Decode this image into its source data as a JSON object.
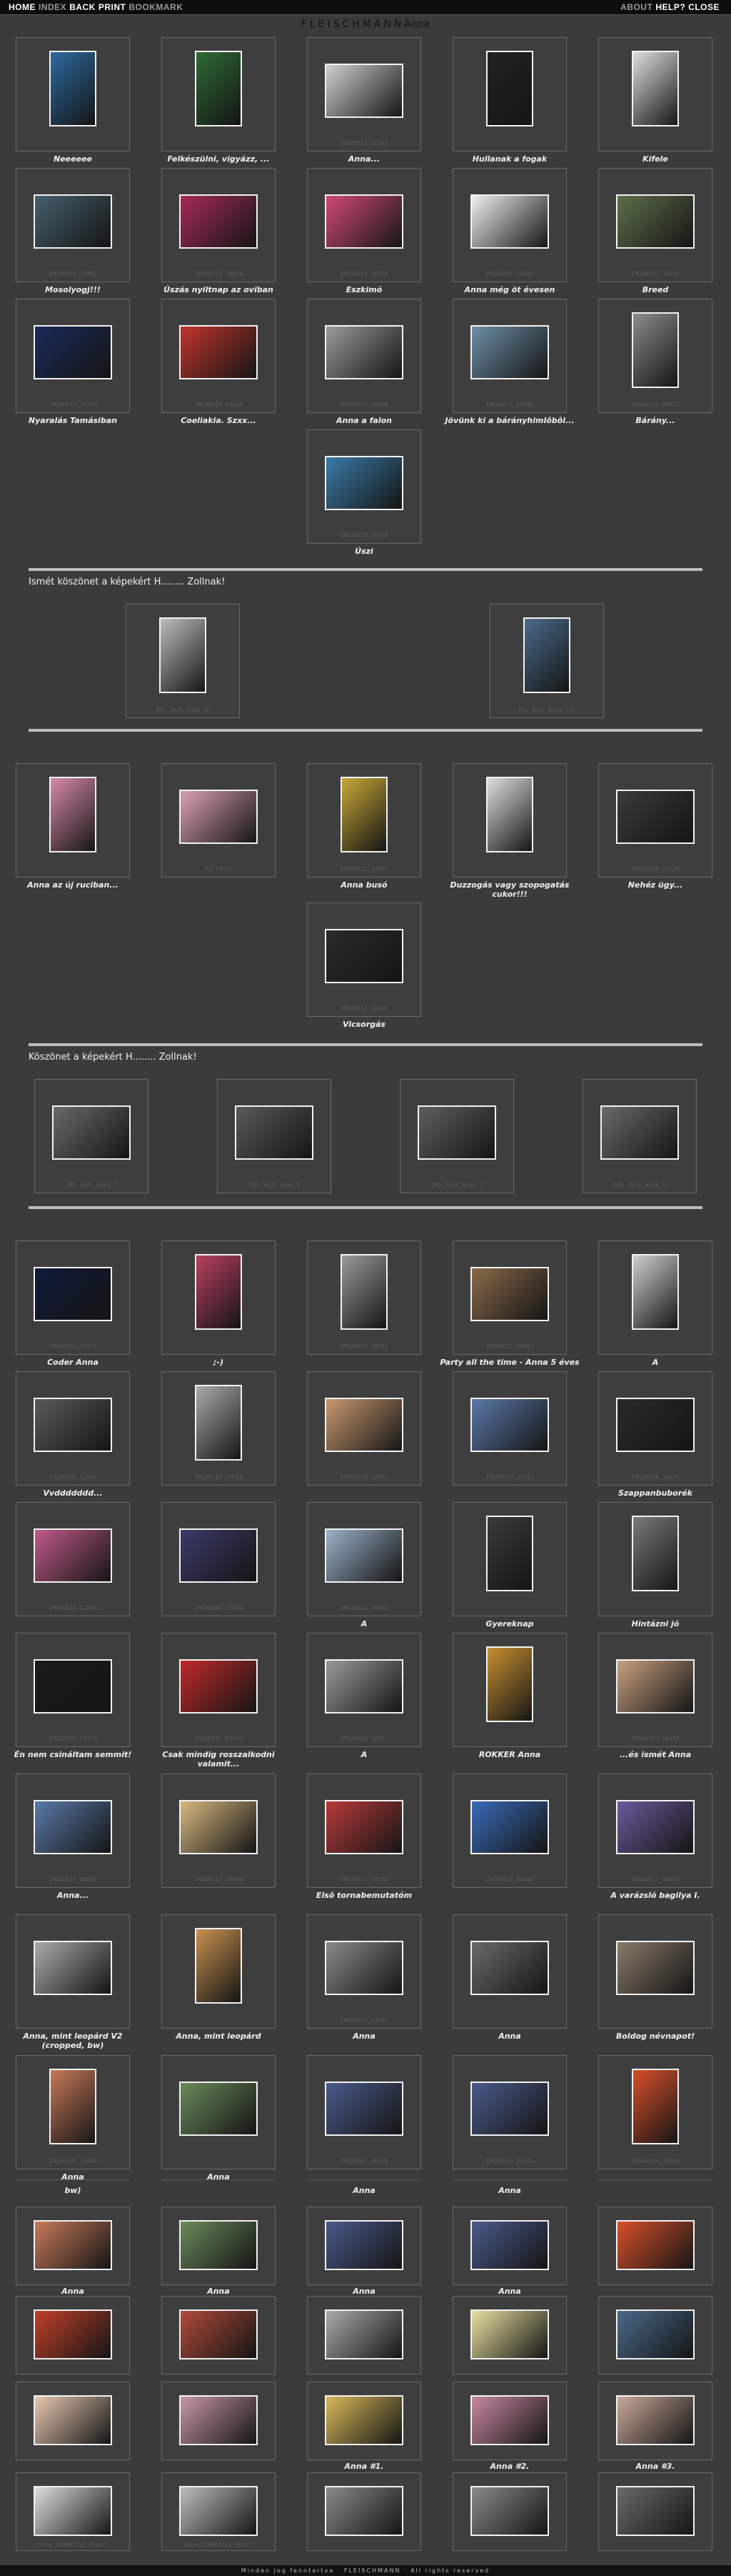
{
  "nav": {
    "left": [
      {
        "label": "HOME",
        "style": "white"
      },
      {
        "label": "INDEX",
        "style": "dim"
      },
      {
        "label": "BACK",
        "style": "white"
      },
      {
        "label": "PRINT",
        "style": "white"
      },
      {
        "label": "BOOKMARK",
        "style": "dim"
      }
    ],
    "right": [
      {
        "label": "ABOUT",
        "style": "dim"
      },
      {
        "label": "HELP?",
        "style": "white"
      },
      {
        "label": "CLOSE",
        "style": "white"
      }
    ]
  },
  "header": {
    "brand": "FLEISCHMANN",
    "subtitle": "Anna"
  },
  "sections": [
    {
      "title": "",
      "rows": [
        [
          {
            "caption": "Neeeeee",
            "file": "",
            "tone": "#2c6aa0",
            "portrait": true
          },
          {
            "caption": "Felkészülni, vigyázz, ...",
            "file": "",
            "tone": "#2f6a34",
            "portrait": true
          },
          {
            "caption": "Anna...",
            "file": "IMG00021_22585",
            "tone": "#cfcfcf",
            "portrait": false
          },
          {
            "caption": "Hullanak a fogak",
            "file": "",
            "tone": "#222222",
            "portrait": true
          },
          {
            "caption": "Kifele",
            "file": "",
            "tone": "#dedede",
            "portrait": true
          }
        ],
        [
          {
            "caption": "Mosolyogj!!!",
            "file": "IMG00019_13882",
            "tone": "#46606e",
            "portrait": false
          },
          {
            "caption": "Úszás nyiltnap az oviban",
            "file": "IMG00516_18876",
            "tone": "#a62a5a",
            "portrait": false
          },
          {
            "caption": "Eszkimó",
            "file": "IMG00014_18126",
            "tone": "#d14a76",
            "portrait": false
          },
          {
            "caption": "Anna még öt évesen",
            "file": "IMG00007_10064",
            "tone": "#f0f0f0",
            "portrait": false
          },
          {
            "caption": "Breed",
            "file": "IMG00567_16641",
            "tone": "#5e6f4a",
            "portrait": false
          }
        ],
        [
          {
            "caption": "Nyaralás Tamásiban",
            "file": "IMG00574_19226",
            "tone": "#1c2b5a",
            "portrait": false
          },
          {
            "caption": "Coeliakia. Szxx...",
            "file": "IMG00516_00474",
            "tone": "#c0362e",
            "portrait": false
          },
          {
            "caption": "Anna a falon",
            "file": "IMG00511_00606",
            "tone": "#9a9a9a",
            "portrait": false
          },
          {
            "caption": "Jövünk ki a bárányhimlőből...",
            "file": "IMG00516_00606",
            "tone": "#6e90a8",
            "portrait": false
          },
          {
            "caption": "Bárány...",
            "file": "IMG00511_00477",
            "tone": "#8c8c8c",
            "portrait": true
          }
        ],
        [
          {
            "caption": "Úszi",
            "file": "IMG00518_00599",
            "tone": "#3a7ba8",
            "portrait": false
          }
        ]
      ]
    },
    {
      "title": "Ismét köszönet a képekért H........ Zollnak!",
      "rows": [
        [
          {
            "caption": "",
            "file": "IMG_3626_Anna_bw",
            "tone": "#bdbdbd",
            "portrait": true
          },
          {
            "caption": "",
            "file": "IMG_3626_Anna_col",
            "tone": "#4a6a8a",
            "portrait": true
          }
        ]
      ]
    },
    {
      "title": "",
      "rows": [
        [
          {
            "caption": "Anna az új ruciban...",
            "file": "",
            "tone": "#d88aa8",
            "portrait": true
          },
          {
            "caption": "",
            "file": "PICT0033",
            "tone": "#d9a0b0",
            "portrait": false
          },
          {
            "caption": "Anna busó",
            "file": "IMG00512_14007",
            "tone": "#c8a838",
            "portrait": true
          },
          {
            "caption": "Duzzogás vagy szopogatás cukor!!!",
            "file": "",
            "tone": "#dedede",
            "portrait": true
          },
          {
            "caption": "Nehéz ügy...",
            "file": "IMG00518_00320",
            "tone": "#3a3a3a",
            "portrait": false
          }
        ],
        [
          {
            "caption": "Vicsorgás",
            "file": "IMG00518_00305",
            "tone": "#2a2a2a",
            "portrait": false
          }
        ]
      ]
    },
    {
      "title": "Köszönet a képekért H........ Zollnak!",
      "rows": [
        [
          {
            "caption": "",
            "file": "IMG_3642_anna_1",
            "tone": "#6a6a6a",
            "portrait": false
          },
          {
            "caption": "",
            "file": "IMG_3626_anna_2",
            "tone": "#5a5a5a",
            "portrait": false
          },
          {
            "caption": "",
            "file": "IMG_3626_anna_3",
            "tone": "#5f5f5f",
            "portrait": false
          },
          {
            "caption": "",
            "file": "IMG_3626_anna_4",
            "tone": "#6a6a6a",
            "portrait": false
          }
        ]
      ]
    },
    {
      "title": "",
      "rows": [
        [
          {
            "caption": "Coder Anna",
            "file": "IMG00516_01022",
            "tone": "#0f1a3a",
            "portrait": false
          },
          {
            "caption": ";-)",
            "file": "",
            "tone": "#b94060",
            "portrait": true
          },
          {
            "caption": "",
            "file": "IMG00518_08601",
            "tone": "#9a9a9a",
            "portrait": true
          },
          {
            "caption": "Party all the time - Anna 5 éves",
            "file": "IMG00516_06887",
            "tone": "#8a6a4a",
            "portrait": false
          },
          {
            "caption": "A",
            "file": "",
            "tone": "#cfcfcf",
            "portrait": true
          }
        ],
        [
          {
            "caption": "Vvddddddd...",
            "file": "IMG00518_12005",
            "tone": "#5a5a5a",
            "portrait": false
          },
          {
            "caption": "",
            "file": "IMG00518_08621",
            "tone": "#aaaaaa",
            "portrait": true
          },
          {
            "caption": "",
            "file": "IMG00518_08862",
            "tone": "#c89870",
            "portrait": false
          },
          {
            "caption": "",
            "file": "IMG00519_09682",
            "tone": "#5a78a8",
            "portrait": false
          },
          {
            "caption": "Szappanbuborék",
            "file": "IMG00518_10686",
            "tone": "#2a2a2a",
            "portrait": false
          }
        ],
        [
          {
            "caption": "",
            "file": "IMG00510_12009",
            "tone": "#c05a8a",
            "portrait": false
          },
          {
            "caption": "",
            "file": "IMG00509_22440",
            "tone": "#3a3a6a",
            "portrait": false
          },
          {
            "caption": "A",
            "file": "IMG00510_08402",
            "tone": "#9ab0c8",
            "portrait": false
          },
          {
            "caption": "Gyereknap",
            "file": "",
            "tone": "#3a3a3a",
            "portrait": true
          },
          {
            "caption": "Hintázni jó",
            "file": "",
            "tone": "#7a7a7a",
            "portrait": true
          }
        ],
        [
          {
            "caption": "Én nem csináltam semmit!",
            "file": "IMG00506_18328",
            "tone": "#1a1a1a",
            "portrait": false
          },
          {
            "caption": "Csak mindig rosszalkodni valamit...",
            "file": "IMG00516_00407",
            "tone": "#c02a2a",
            "portrait": false
          },
          {
            "caption": "A",
            "file": "IMG00506_18812",
            "tone": "#9a9a9a",
            "portrait": false
          },
          {
            "caption": "ROKKER Anna",
            "file": "",
            "tone": "#c89030",
            "portrait": true
          },
          {
            "caption": "...és ismét Anna",
            "file": "IMG00503_08488",
            "tone": "#c8a080",
            "portrait": false
          }
        ],
        [
          {
            "caption": "Anna...",
            "file": "IMG00511_08885",
            "tone": "#5a7aa8",
            "portrait": false
          },
          {
            "caption": "",
            "file": "IMG00517_06690",
            "tone": "#d8b880",
            "portrait": false
          },
          {
            "caption": "Első tornabemutatóm",
            "file": "IMG00517_17436",
            "tone": "#b83a3a",
            "portrait": false
          },
          {
            "caption": "",
            "file": "IMG00516_00408",
            "tone": "#3a6ab8",
            "portrait": false
          },
          {
            "caption": "A varázsló bagilya I.",
            "file": "IMG00517_06436",
            "tone": "#6a5a9a",
            "portrait": false
          }
        ],
        [
          {
            "caption": "Anna, mint leopárd V2 (cropped, bw)",
            "file": "",
            "tone": "#aaaaaa",
            "portrait": false
          },
          {
            "caption": "Anna, mint leopárd",
            "file": "",
            "tone": "#c89050",
            "portrait": true
          },
          {
            "caption": "Anna",
            "file": "IMG00516_12681",
            "tone": "#8a8a8a",
            "portrait": false
          },
          {
            "caption": "Anna",
            "file": "",
            "tone": "#6a6a6a",
            "portrait": false
          },
          {
            "caption": "Boldog névnapot!",
            "file": "",
            "tone": "#8a7a6a",
            "portrait": false
          }
        ],
        [
          {
            "caption": "Anna",
            "file": "IMG00510_15883",
            "tone": "#c87a5a",
            "portrait": true
          },
          {
            "caption": "Anna",
            "file": "",
            "tone": "#6a8a5a",
            "portrait": false
          },
          {
            "caption": "",
            "file": "IMG00507_08109",
            "tone": "#4a5a8a",
            "portrait": false
          },
          {
            "caption": "",
            "file": "IMG00510_08109",
            "tone": "#4a5a8a",
            "portrait": false
          },
          {
            "caption": "",
            "file": "IMG00514_18006",
            "tone": "#d8502a",
            "portrait": true
          }
        ]
      ]
    }
  ],
  "ghost_strip": [
    {
      "caption": "bw)"
    },
    {
      "caption": ""
    },
    {
      "caption": "Anna"
    },
    {
      "caption": "Anna"
    },
    {
      "caption": ""
    }
  ],
  "lower_rows": [
    [
      {
        "caption": "Anna",
        "file": "",
        "tone": "#c87a5a"
      },
      {
        "caption": "Anna",
        "file": "",
        "tone": "#6a8a5a"
      },
      {
        "caption": "Anna",
        "file": "",
        "tone": "#4a5a8a"
      },
      {
        "caption": "Anna",
        "file": "",
        "tone": "#4a5a8a"
      },
      {
        "caption": "",
        "file": "",
        "tone": "#d8502a"
      }
    ],
    [
      {
        "caption": "",
        "file": "",
        "tone": "#c0402a"
      },
      {
        "caption": "",
        "file": "",
        "tone": "#b04a3a"
      },
      {
        "caption": "",
        "file": "",
        "tone": "#aaaaaa"
      },
      {
        "caption": "",
        "file": "",
        "tone": "#e8e0a0"
      },
      {
        "caption": "",
        "file": "",
        "tone": "#4a6a8a"
      }
    ],
    [
      {
        "caption": "",
        "file": "",
        "tone": "#e8c8b0"
      },
      {
        "caption": "",
        "file": "",
        "tone": "#c898a8"
      },
      {
        "caption": "Anna #1.",
        "file": "",
        "tone": "#d8b85a"
      },
      {
        "caption": "Anna #2.",
        "file": "",
        "tone": "#c888a0"
      },
      {
        "caption": "Anna #3.",
        "file": "",
        "tone": "#c8a898"
      }
    ],
    [
      {
        "caption": "",
        "file": "Anna_ZIMMATTLE_Mobil",
        "tone": "#dedede"
      },
      {
        "caption": "",
        "file": "Anna_ZIMMATTLE_Mobil",
        "tone": "#bdbdbd"
      },
      {
        "caption": "",
        "file": "",
        "tone": "#8a8a8a"
      },
      {
        "caption": "",
        "file": "",
        "tone": "#8a8a8a"
      },
      {
        "caption": "",
        "file": "",
        "tone": "#6a6a6a"
      }
    ]
  ],
  "footer": {
    "text": "Minden jog fenntartva · FLEISCHMANN · All rights reserved"
  }
}
